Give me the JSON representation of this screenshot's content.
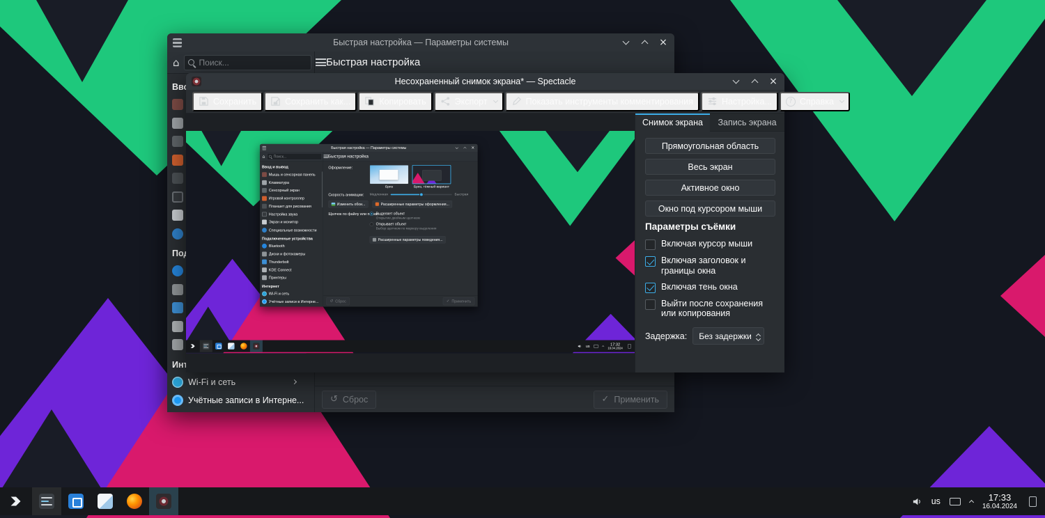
{
  "colors": {
    "accent": "#3daee9",
    "wallpaper_green": "#1ec87c",
    "wallpaper_purple": "#6e25d8",
    "wallpaper_magenta": "#d9196c"
  },
  "glyphs": {
    "home": "⌂",
    "close": "×",
    "reset": "↺",
    "apply": "✓",
    "question": "?"
  },
  "settings": {
    "titlebar": "Быстрая настройка — Параметры системы",
    "search_placeholder": "Поиск...",
    "page_title": "Быстрая настройка",
    "sections": [
      {
        "label": "Ввод и вывод",
        "items": [
          {
            "label": "Мышь и сенсорная панель"
          },
          {
            "label": "Клавиатура"
          },
          {
            "label": "Сенсорный экран"
          },
          {
            "label": "Игровой контроллер"
          },
          {
            "label": "Планшет для рисования"
          },
          {
            "label": "Настройка звука"
          },
          {
            "label": "Экран и монитор"
          },
          {
            "label": "Специальные возможности"
          }
        ]
      },
      {
        "label": "Подключенные устройства",
        "items": [
          {
            "label": "Bluetooth"
          },
          {
            "label": "Диски и фотокамеры"
          },
          {
            "label": "Thunderbolt"
          },
          {
            "label": "KDE Connect"
          },
          {
            "label": "Принтеры"
          }
        ]
      },
      {
        "label": "Интернет",
        "items": [
          {
            "label": "Wi-Fi и сеть"
          },
          {
            "label": "Учётные записи в Интерне..."
          }
        ]
      }
    ],
    "reset_label": "Сброс",
    "apply_label": "Применить",
    "content": {
      "appearance_label": "Оформление:",
      "themes": [
        {
          "name": "Бриз",
          "selected": false
        },
        {
          "name": "Бриз, тёмный вариант",
          "selected": true
        }
      ],
      "anim_label": "Скорость анимации:",
      "anim_slow": "Медленная",
      "anim_fast": "Быстрая",
      "wallpaper_btn": "Изменить обои...",
      "adv_appearance_btn": "Расширенные параметры оформления...",
      "click_label": "Щелчок по файлу или папке:",
      "click_options": [
        {
          "label": "Выделяет объект",
          "desc": "Открытие двойным щелчком",
          "selected": true
        },
        {
          "label": "Открывает объект",
          "desc": "Выбор щелчком по маркеру выделения",
          "selected": false
        }
      ],
      "adv_behavior_btn": "Расширенные параметры поведения..."
    }
  },
  "spectacle": {
    "titlebar": "Несохраненный снимок экрана* — Spectacle",
    "toolbar": {
      "save": "Сохранить",
      "save_as": "Сохранить как...",
      "copy": "Копировать",
      "export": "Экспорт",
      "annotate": "Показать инструменты комментирования",
      "configure": "Настройка...",
      "help": "Справка"
    },
    "tabs": {
      "screenshot": "Снимок экрана",
      "recording": "Запись экрана"
    },
    "capture_modes": [
      "Прямоугольная область",
      "Весь экран",
      "Активное окно",
      "Окно под курсором мыши"
    ],
    "options_heading": "Параметры съёмки",
    "options": [
      {
        "label": "Включая курсор мыши",
        "checked": false
      },
      {
        "label": "Включая заголовок и границы окна",
        "checked": true
      },
      {
        "label": "Включая тень окна",
        "checked": true
      },
      {
        "label": "Выйти после сохранения или копирования",
        "checked": false
      }
    ],
    "delay_label": "Задержка:",
    "delay_value": "Без задержки"
  },
  "taskbar": {
    "keyboard": "us",
    "time": "17:33",
    "date": "16.04.2024"
  },
  "preview": {
    "time": "17:32",
    "date": "16.04.2024"
  }
}
